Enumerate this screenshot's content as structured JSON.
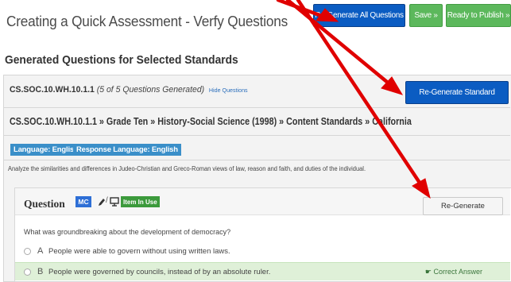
{
  "page": {
    "title": "Creating a Quick Assessment - Verfy Questions"
  },
  "toolbar": {
    "regenerate_all_label": "Re-Generate All Questions",
    "save_label": "Save »",
    "ready_label": "Ready to Publish »"
  },
  "section": {
    "title": "Generated Questions for Selected Standards"
  },
  "standard": {
    "code": "CS.SOC.10.WH.10.1.1",
    "count_text": "(5 of 5 Questions Generated)",
    "hide_link": "Hide Questions",
    "regenerate_label": "Re-Generate Standard",
    "breadcrumb": "CS.SOC.10.WH.10.1.1 » Grade Ten » History-Social Science (1998) » Content Standards » California",
    "tags": [
      "Language: English",
      "Response Language: English"
    ],
    "description": "Analyze the similarities and differences in Judeo-Christian and Greco-Roman views of law, reason and faith, and duties of the individual."
  },
  "question": {
    "label": "Question",
    "type_badge": "MC",
    "status_badge": "Item In Use",
    "regenerate_label": "Re-Generate",
    "text": "What was groundbreaking about the development of democracy?",
    "answers": [
      {
        "letter": "A",
        "text": "People were able to govern without using written laws.",
        "correct": false
      },
      {
        "letter": "B",
        "text": "People were governed by councils, instead of by an absolute ruler.",
        "correct": true
      }
    ],
    "correct_label": "Correct Answer"
  },
  "annotations": {
    "arrow_color": "#e00000"
  },
  "icons": [
    "pencil-icon",
    "monitor-icon",
    "thumbs-up-icon",
    "radio-icon"
  ]
}
